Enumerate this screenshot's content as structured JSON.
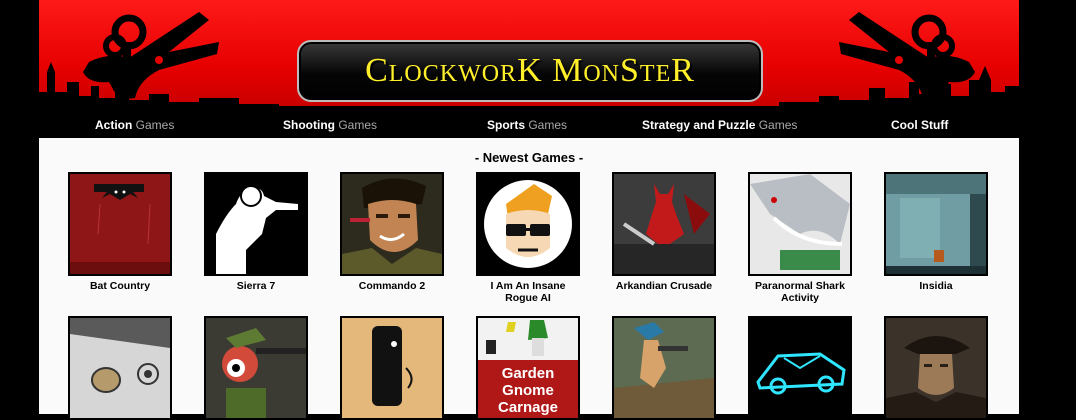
{
  "site": {
    "logo_text": "ClockworK MonSteR"
  },
  "nav": {
    "items": [
      {
        "bold": "Action",
        "gray": " Games"
      },
      {
        "bold": "Shooting",
        "gray": " Games"
      },
      {
        "bold": "Sports",
        "gray": " Games"
      },
      {
        "bold": "Strategy and Puzzle",
        "gray": " Games"
      },
      {
        "bold": "Cool Stuff",
        "gray": ""
      }
    ]
  },
  "newest": {
    "title": "- Newest Games -",
    "row1": [
      {
        "title": "Bat Country",
        "icon": "bat-country-thumbnail"
      },
      {
        "title": "Sierra 7",
        "icon": "sierra-7-thumbnail"
      },
      {
        "title": "Commando 2",
        "icon": "commando-2-thumbnail"
      },
      {
        "title": "I Am An Insane Rogue AI",
        "icon": "rogue-ai-thumbnail"
      },
      {
        "title": "Arkandian Crusade",
        "icon": "arkandian-crusade-thumbnail"
      },
      {
        "title": "Paranormal Shark Activity",
        "icon": "paranormal-shark-thumbnail"
      },
      {
        "title": "Insidia",
        "icon": "insidia-thumbnail"
      }
    ],
    "row2": [
      {
        "icon": "game-thumbnail-8"
      },
      {
        "icon": "game-thumbnail-9"
      },
      {
        "icon": "game-thumbnail-10"
      },
      {
        "thumb_text": [
          "Garden",
          "Gnome",
          "Carnage"
        ],
        "icon": "garden-gnome-carnage-thumbnail"
      },
      {
        "icon": "game-thumbnail-12"
      },
      {
        "icon": "game-thumbnail-13"
      },
      {
        "icon": "game-thumbnail-14"
      }
    ]
  },
  "colors": {
    "header_red": "#e60000",
    "logo_yellow": "#ffef2a",
    "nav_bg": "#000000"
  }
}
